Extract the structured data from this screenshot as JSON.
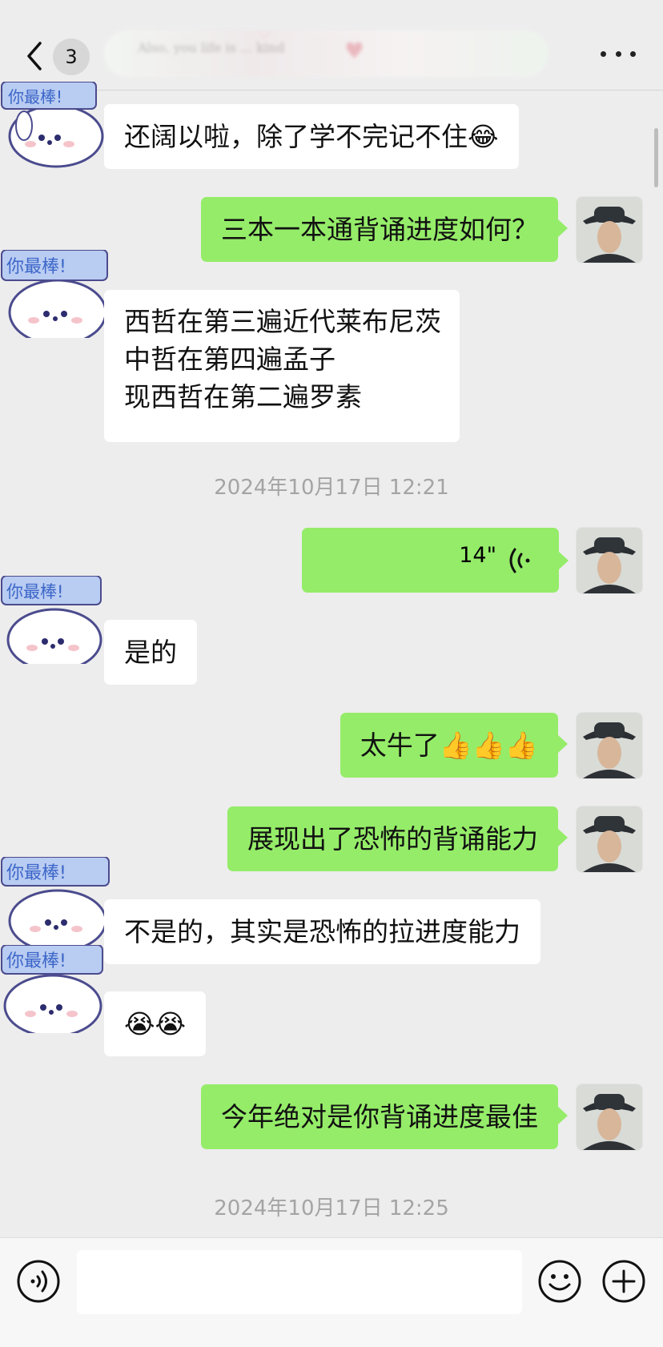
{
  "header": {
    "back_count": "3",
    "blurred_note": "Also, you life is ... kind"
  },
  "messages": [
    {
      "side": "in",
      "text": "还阔以啦，除了学不完记不住😂"
    },
    {
      "side": "out",
      "text": "三本一本通背诵进度如何？"
    },
    {
      "side": "in",
      "lines": [
        "西哲在第三遍近代莱布尼茨",
        "中哲在第四遍孟子",
        "现西哲在第二遍罗素"
      ]
    },
    {
      "type": "time",
      "text": "2024年10月17日 12:21"
    },
    {
      "side": "out",
      "type": "voice",
      "duration": "14\""
    },
    {
      "side": "in",
      "text": "是的"
    },
    {
      "side": "out",
      "text": "太牛了👍👍👍"
    },
    {
      "side": "out",
      "text": "展现出了恐怖的背诵能力"
    },
    {
      "side": "in",
      "text": "不是的，其实是恐怖的拉进度能力"
    },
    {
      "side": "in",
      "text": "😭😭"
    },
    {
      "side": "out",
      "text": "今年绝对是你背诵进度最佳"
    },
    {
      "type": "time",
      "text": "2024年10月17日 12:25"
    }
  ],
  "avatars": {
    "sticker_text": "你最棒!",
    "right_label": "man-in-hat"
  },
  "colors": {
    "bubble_out": "#95EC69",
    "bubble_in": "#FFFFFF",
    "background": "#EDEDED"
  },
  "composer": {
    "input_value": "",
    "input_placeholder": ""
  }
}
